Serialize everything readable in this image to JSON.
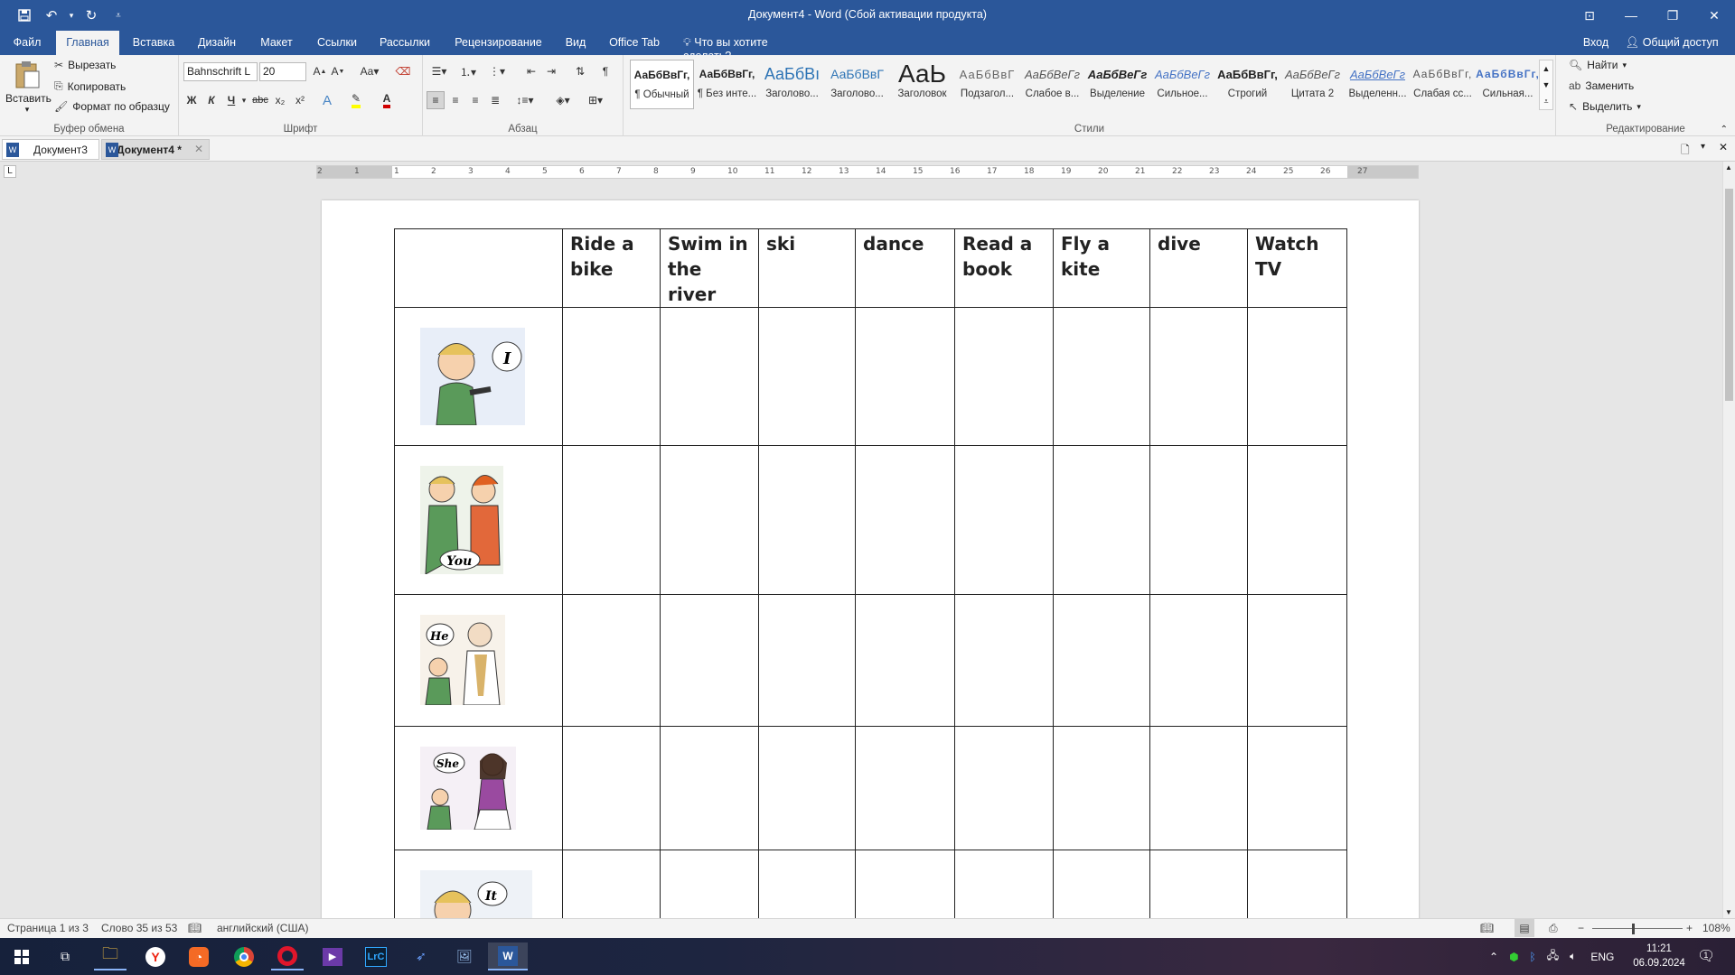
{
  "title_bar": {
    "title": "Документ4 - Word (Сбой активации продукта)",
    "qat": {
      "save_icon": "save-icon",
      "undo_icon": "undo-icon",
      "redo_icon": "redo-icon",
      "customize_icon": "qat-dropdown-icon"
    }
  },
  "ribbon_tabs": {
    "file": "Файл",
    "home": "Главная",
    "insert": "Вставка",
    "design": "Дизайн",
    "layout": "Макет",
    "references": "Ссылки",
    "mailings": "Рассылки",
    "review": "Рецензирование",
    "view": "Вид",
    "office_tab": "Office Tab",
    "tell_me": "Что вы хотите сделать?",
    "sign_in": "Вход",
    "share": "Общий доступ"
  },
  "clipboard": {
    "paste": "Вставить",
    "cut": "Вырезать",
    "copy": "Копировать",
    "format_painter": "Формат по образцу",
    "label": "Буфер обмена"
  },
  "font": {
    "name": "Bahnschrift L",
    "size": "20",
    "change_case": "Aa",
    "bold": "Ж",
    "italic": "К",
    "underline": "Ч",
    "strike": "abc",
    "sub": "x₂",
    "sup": "x²",
    "label": "Шрифт"
  },
  "paragraph": {
    "label": "Абзац"
  },
  "styles": {
    "label": "Стили",
    "items": [
      {
        "preview": "АаБбВвГг,",
        "name": "¶ Обычный"
      },
      {
        "preview": "АаБбВвГг,",
        "name": "¶ Без инте..."
      },
      {
        "preview": "АаБбВı",
        "name": "Заголово..."
      },
      {
        "preview": "АаБбВвГ",
        "name": "Заголово..."
      },
      {
        "preview": "АаЬ",
        "name": "Заголовок"
      },
      {
        "preview": "АаБбВвГ",
        "name": "Подзагол..."
      },
      {
        "preview": "АаБбВеГг",
        "name": "Слабое в..."
      },
      {
        "preview": "АаБбВеГг",
        "name": "Выделение"
      },
      {
        "preview": "АаБбВеГг",
        "name": "Сильное..."
      },
      {
        "preview": "АаБбВвГг,",
        "name": "Строгий"
      },
      {
        "preview": "АаБбВеГг",
        "name": "Цитата 2"
      },
      {
        "preview": "АаБбВеГг",
        "name": "Выделенн..."
      },
      {
        "preview": "АаБбВвГг,",
        "name": "Слабая сс..."
      },
      {
        "preview": "АаБбВвГг,",
        "name": "Сильная..."
      }
    ]
  },
  "editing": {
    "find": "Найти",
    "replace": "Заменить",
    "select": "Выделить",
    "label": "Редактирование"
  },
  "doc_tabs": {
    "tab1": "Документ3",
    "tab2": "Документ4 *"
  },
  "ruler": {
    "ticks": [
      "2",
      "1",
      "1",
      "2",
      "3",
      "4",
      "5",
      "6",
      "7",
      "8",
      "9",
      "10",
      "11",
      "12",
      "13",
      "14",
      "15",
      "16",
      "17",
      "18",
      "19",
      "20",
      "21",
      "22",
      "23",
      "24",
      "25",
      "26",
      "27"
    ]
  },
  "table": {
    "headers": [
      "Ride a bike",
      "Swim in the river",
      "ski",
      "dance",
      "Read a book",
      "Fly a kite",
      "dive",
      "Watch TV"
    ],
    "pronouns": [
      "I",
      "You",
      "He",
      "She",
      "It"
    ]
  },
  "status": {
    "page": "Страница 1 из 3",
    "words": "Слово 35 из 53",
    "language": "английский (США)",
    "zoom": "108%"
  },
  "taskbar": {
    "lang": "ENG",
    "time": "11:21",
    "date": "06.09.2024",
    "notif_count": "1"
  }
}
